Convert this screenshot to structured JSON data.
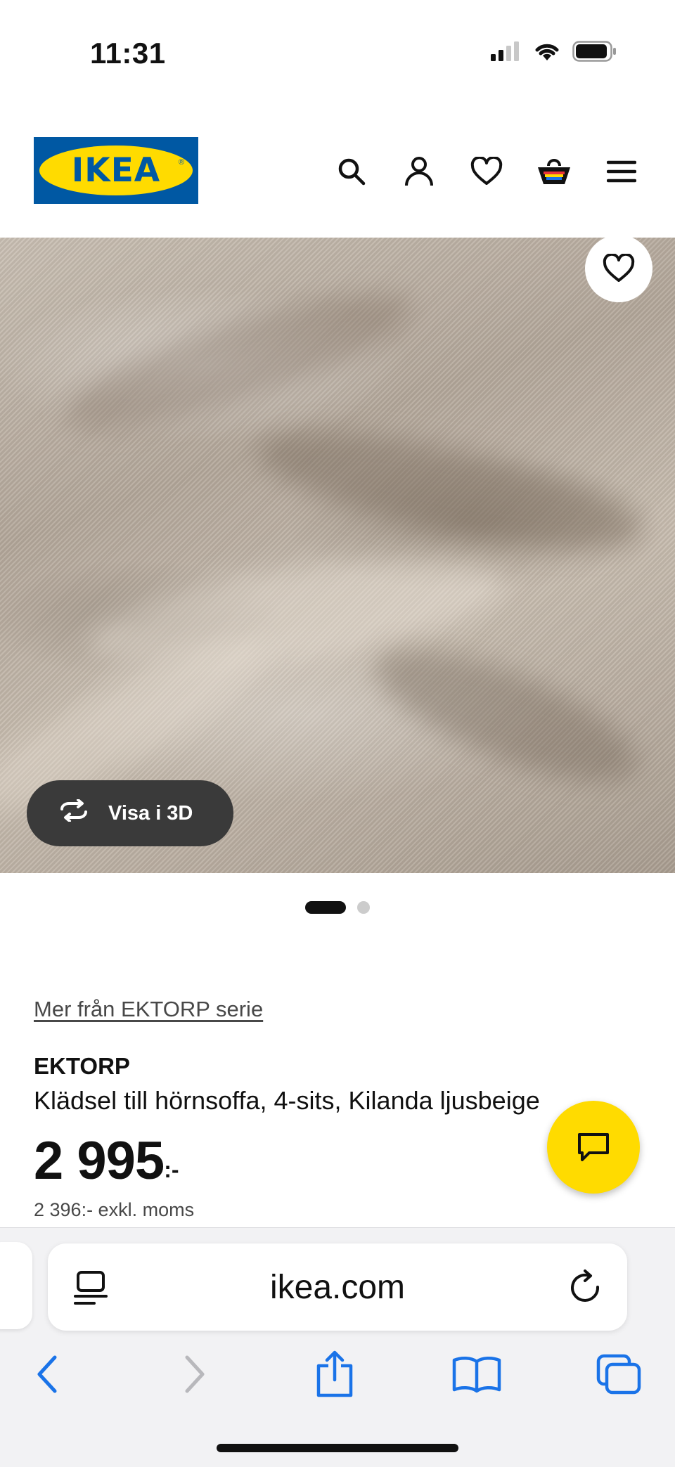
{
  "status": {
    "time": "11:31"
  },
  "header": {
    "logo_text": "IKEA",
    "logo_reg": "®"
  },
  "hero": {
    "view_3d_label": "Visa i 3D",
    "image_description_icon": "fabric-photo",
    "dots_count": 2,
    "active_dot": 1
  },
  "product": {
    "series_link": "Mer från EKTORP serie",
    "name": "EKTORP",
    "description": "Klädsel till hörnsoffa, 4-sits, Kilanda ljusbeige",
    "price_amount": "2 995",
    "price_suffix": ":-",
    "price_ex_vat": "2 396:- exkl. moms"
  },
  "browser": {
    "url": "ikea.com"
  },
  "colors": {
    "ikea_blue": "#0058a3",
    "ikea_yellow": "#ffdb00",
    "ios_blue": "#1a73e8"
  }
}
